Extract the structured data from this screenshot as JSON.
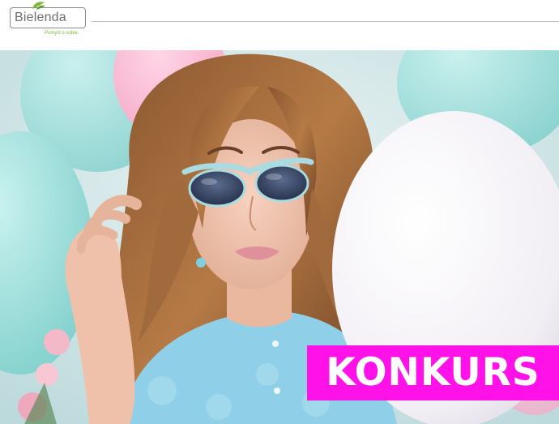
{
  "brand": {
    "logo_text": "Bielenda",
    "tagline": "Pomyśl o sobie."
  },
  "promo": {
    "badge_text": "KONKURS",
    "badge_color": "#ff12e8"
  },
  "hero": {
    "subject": "woman with sunglasses among pastel balloons"
  }
}
